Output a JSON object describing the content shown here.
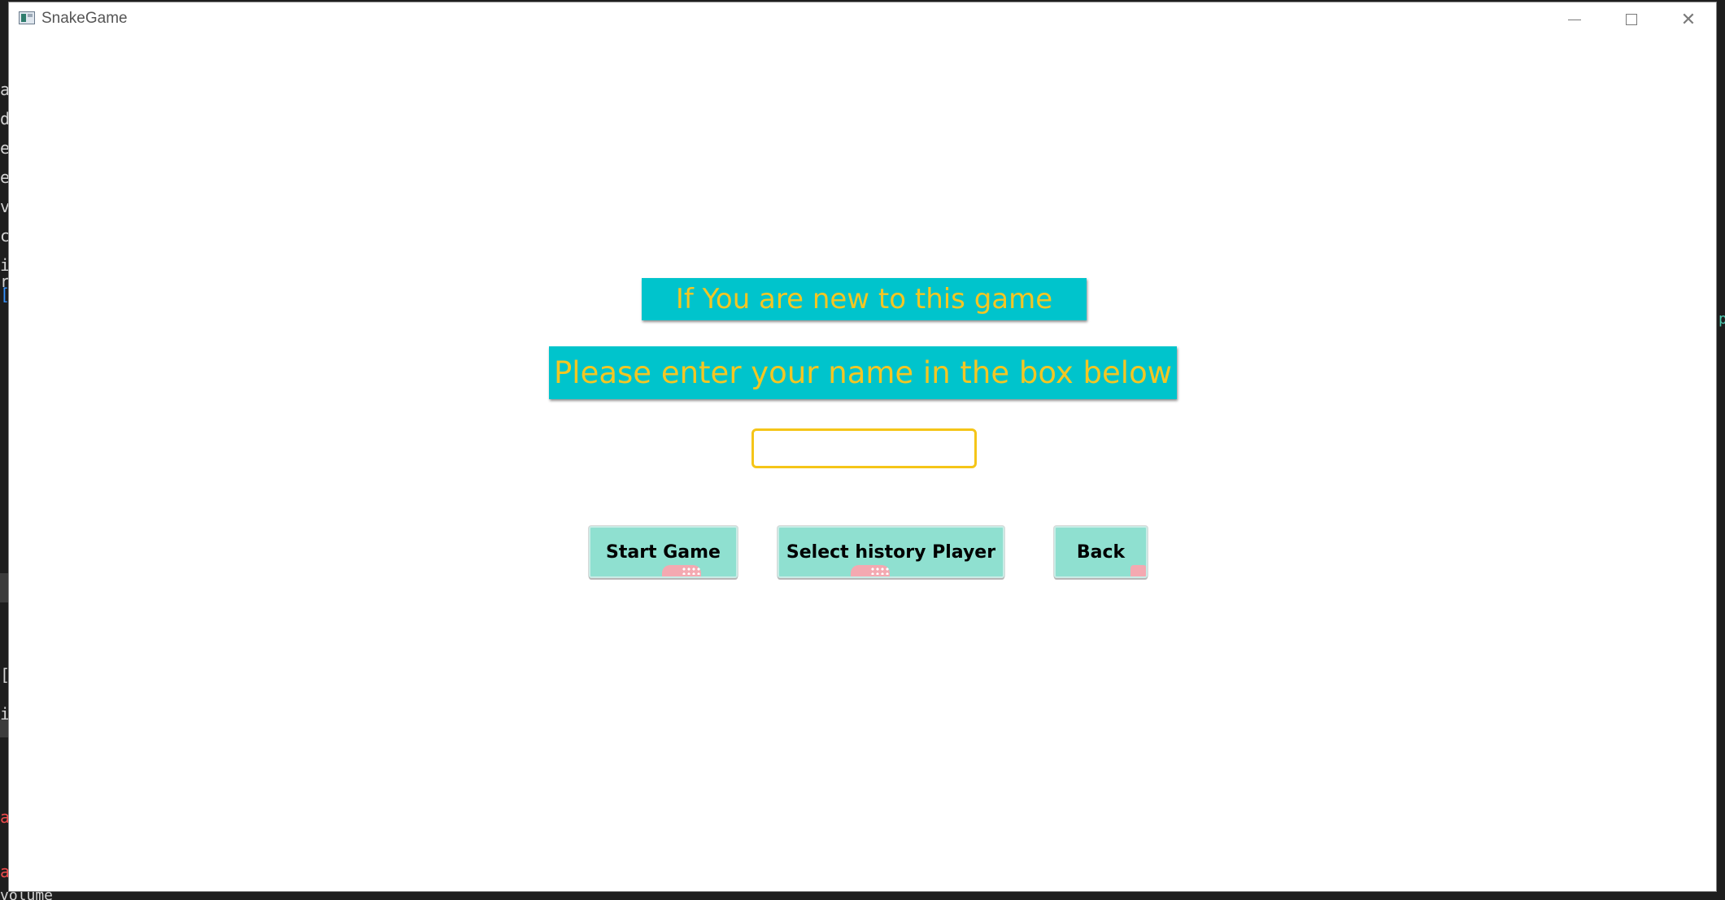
{
  "background": {
    "editor_fragments": [
      "a",
      "d",
      "e",
      "e",
      "v",
      "c",
      "i r",
      "[",
      "[",
      "ir",
      "ac",
      "ac"
    ],
    "right_fragment": "p",
    "bottom_fragment": "volume"
  },
  "window": {
    "title": "SnakeGame",
    "controls": {
      "minimize": "minimize",
      "maximize": "maximize",
      "close": "✕"
    }
  },
  "content": {
    "banner_new": "If You are new to this game",
    "banner_enter": "Please enter your name in the box below",
    "name_input": {
      "value": "",
      "placeholder": ""
    },
    "buttons": {
      "start": "Start Game",
      "history": "Select history Player",
      "back": "Back"
    }
  },
  "colors": {
    "banner_bg": "#00c4cc",
    "banner_text": "#f3c623",
    "button_bg": "#8fe0d0",
    "input_border": "#f5c518"
  }
}
